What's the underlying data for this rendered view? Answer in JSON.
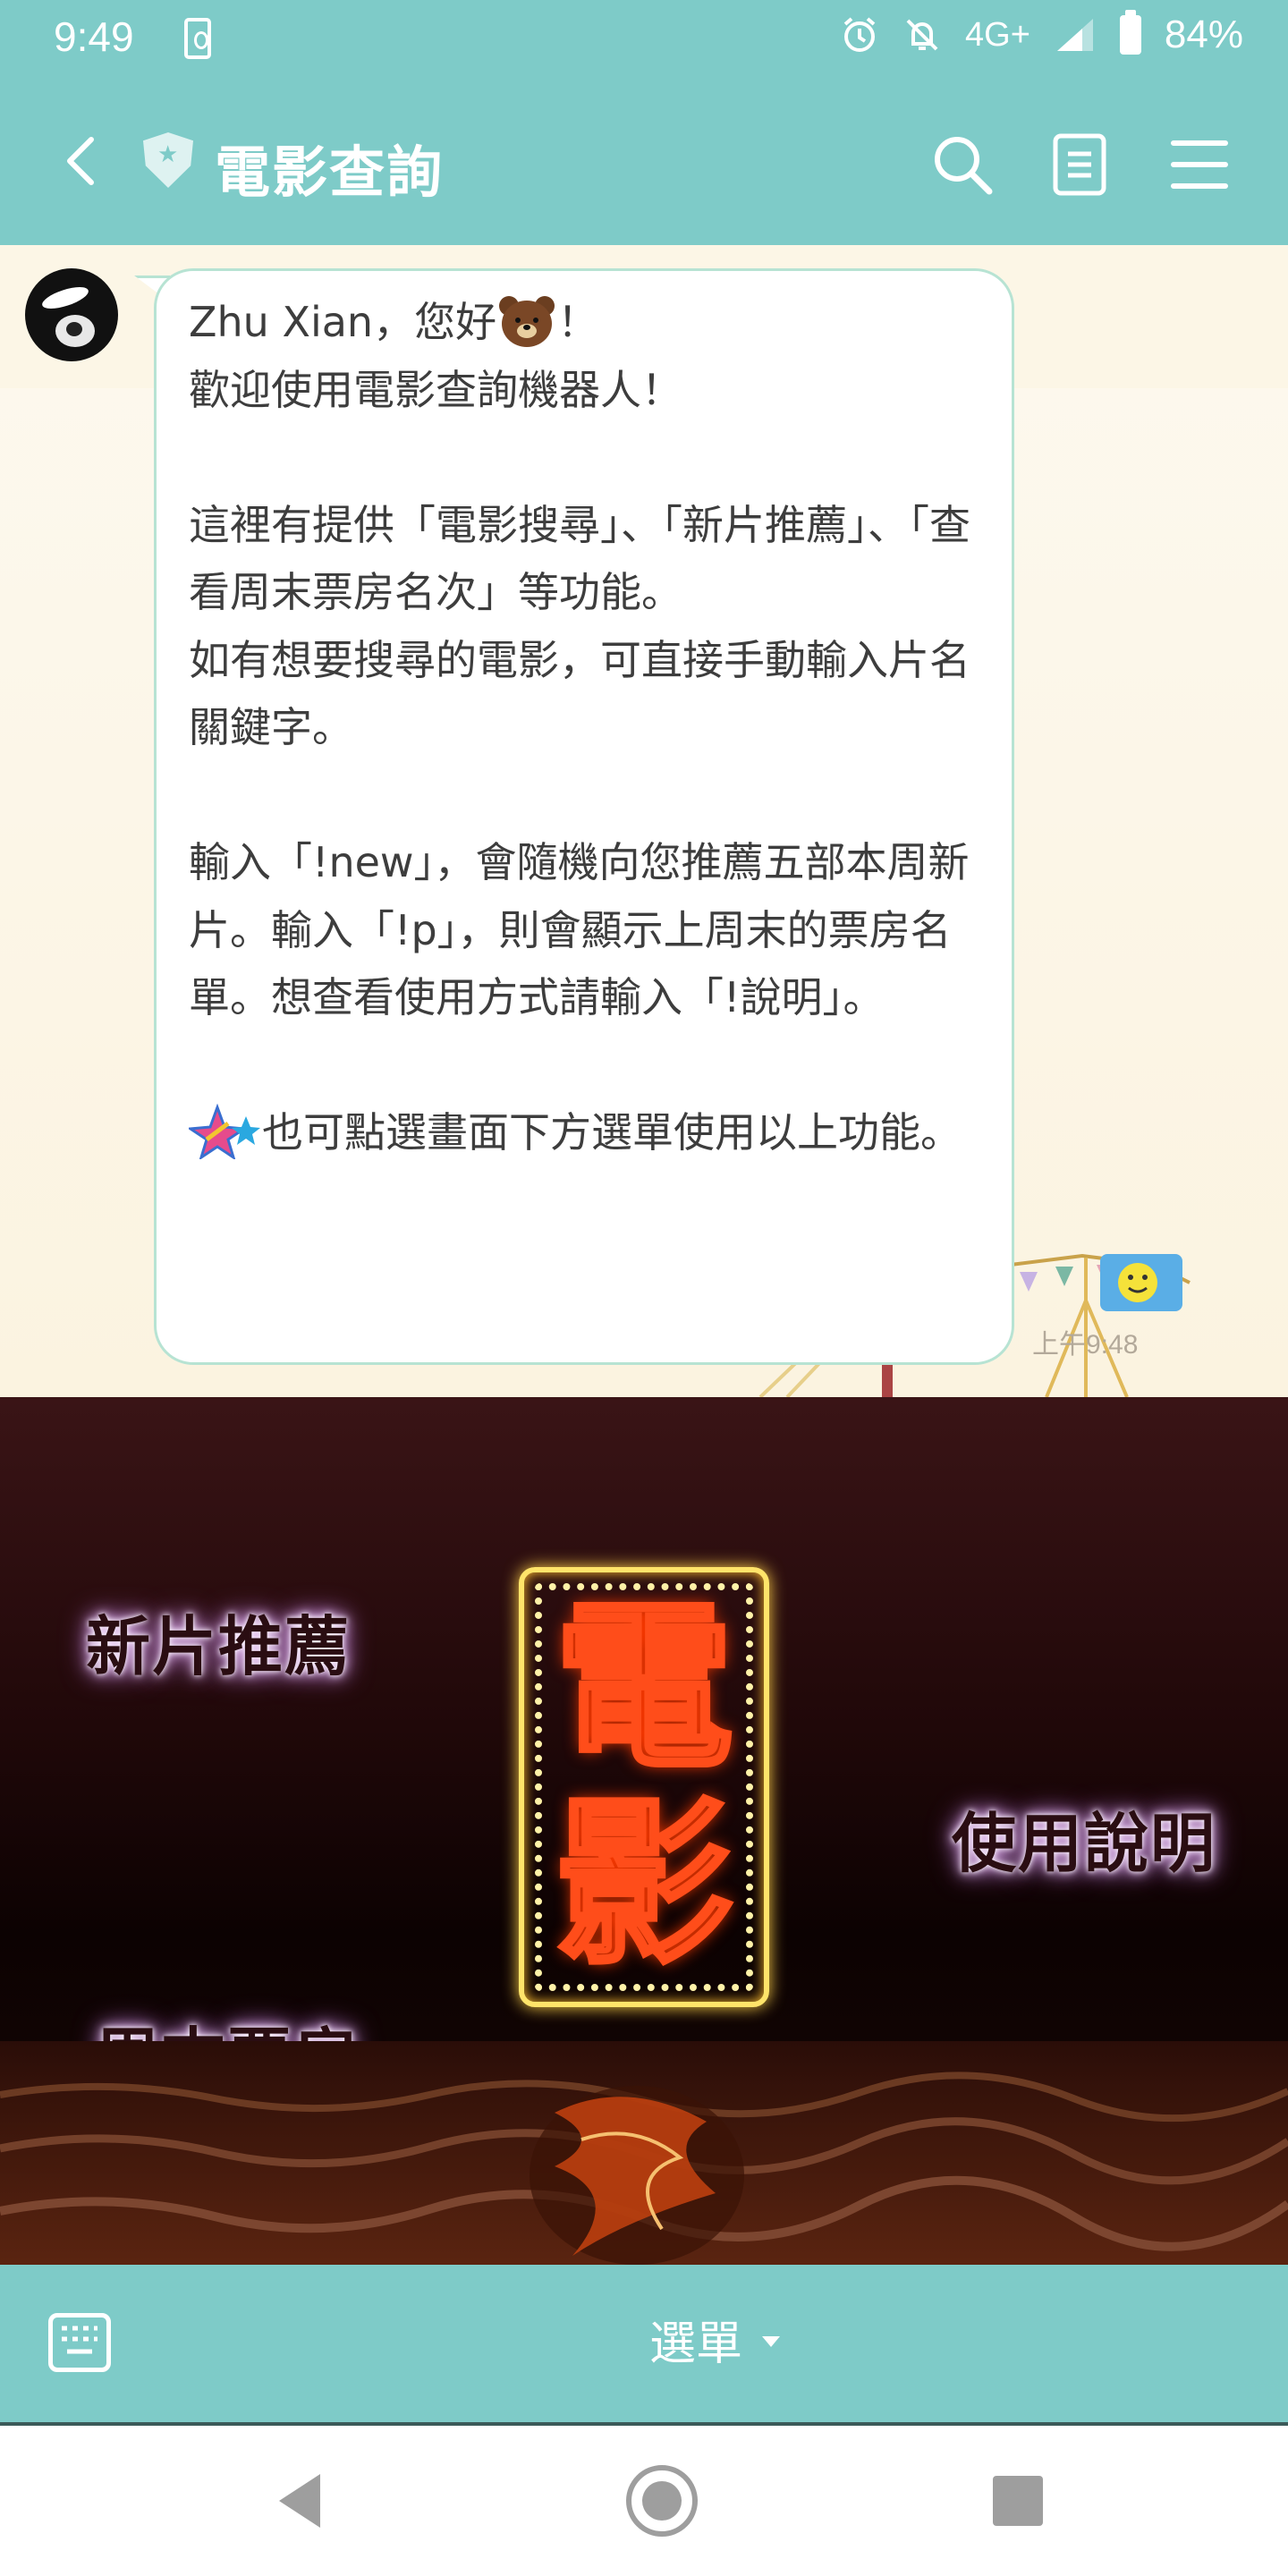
{
  "status_bar": {
    "time": "9:49",
    "network": "4G+",
    "battery": "84%",
    "icons": [
      "sim-card-icon",
      "alarm-icon",
      "mute-icon",
      "signal-icon",
      "battery-icon"
    ]
  },
  "header": {
    "title": "電影查詢",
    "back_icon": "chevron-left-icon",
    "badge_icon": "shield-star-icon",
    "actions": [
      "search-icon",
      "notes-icon",
      "menu-icon"
    ]
  },
  "chat": {
    "message": {
      "greeting_before": "Zhu Xian，您好",
      "greeting_after": "！",
      "welcome": "歡迎使用電影查詢機器人！",
      "para2": "這裡有提供「電影搜尋」、「新片推薦」、「查看周末票房名次」等功能。\n如有想要搜尋的電影，可直接手動輸入片名關鍵字。",
      "para3": "輸入「!new」，會隨機向您推薦五部本周新片。輸入「!p」，則會顯示上周末的票房名單。想查看使用方式請輸入「!說明」。",
      "para4": "也可點選畫面下方選單使用以上功能。",
      "emojis": [
        "brown-bear-emoji",
        "sparkle-stars-emoji"
      ]
    },
    "timestamp": "上午9:48"
  },
  "rich_menu": {
    "items": [
      {
        "label": "新片推薦"
      },
      {
        "label": "使用說明"
      },
      {
        "label": "周末票房"
      }
    ],
    "sign_chars": [
      "電",
      "影"
    ]
  },
  "bottom_bar": {
    "menu_label": "選單",
    "keyboard_icon": "keyboard-icon"
  },
  "nav_bar": {
    "buttons": [
      "back-triangle-icon",
      "home-circle-icon",
      "recents-square-icon"
    ]
  },
  "colors": {
    "theme": "#7ecbc8",
    "bubble_border": "#b7e3d3",
    "chat_bg": "#fdf9ef",
    "neon_frame": "#ffe46a",
    "neon_text": "#ff4d1a"
  }
}
